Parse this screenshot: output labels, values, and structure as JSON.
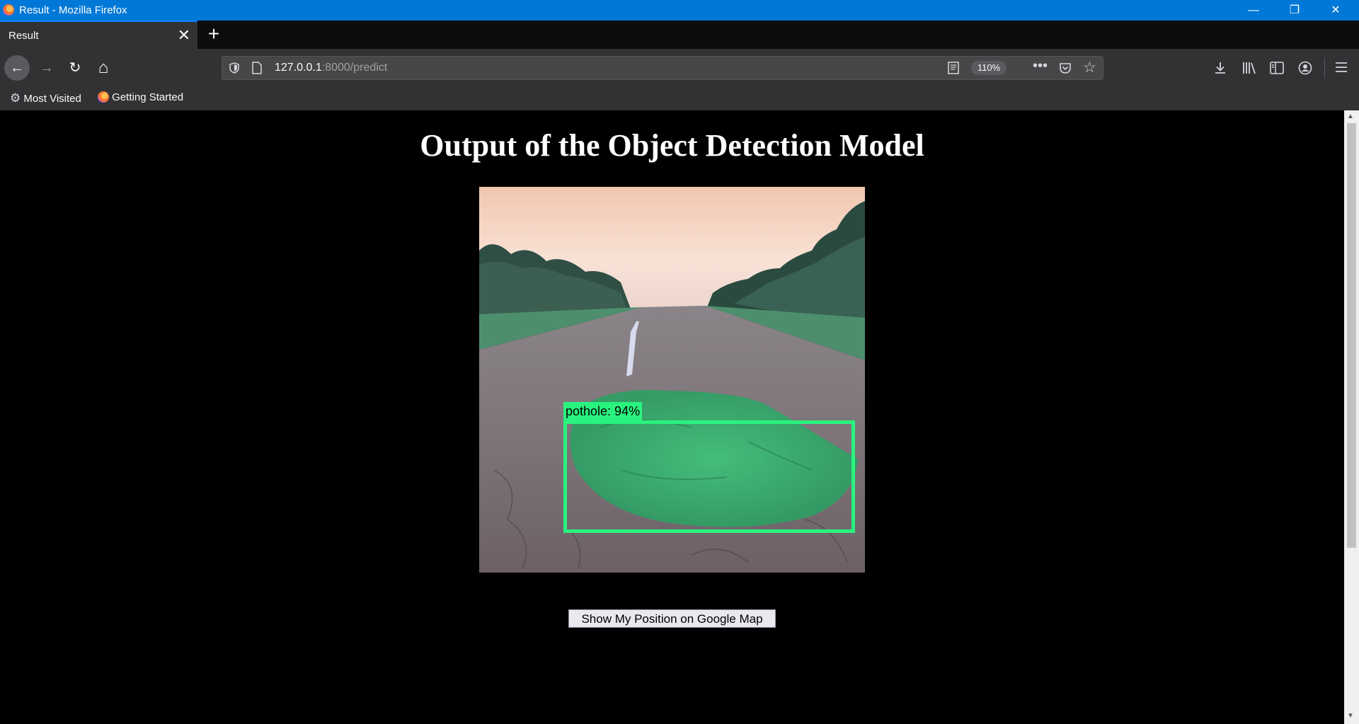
{
  "window": {
    "title": "Result - Mozilla Firefox",
    "minimize": "—",
    "restore": "❐",
    "close": "✕"
  },
  "tabs": [
    {
      "label": "Result",
      "close": "✕"
    }
  ],
  "new_tab": "+",
  "nav": {
    "back": "←",
    "forward": "→",
    "reload": "↻",
    "home": "⌂"
  },
  "urlbar": {
    "host": "127.0.0.1",
    "path": ":8000/predict",
    "zoom": "110%"
  },
  "toolbar_icons": [
    "reader-view-icon",
    "more-actions-icon",
    "pocket-icon",
    "bookmark-star-icon",
    "downloads-icon",
    "library-icon",
    "sidebar-icon",
    "account-icon",
    "menu-icon"
  ],
  "bookmarks": [
    {
      "label": "Most Visited",
      "icon": "gear-icon"
    },
    {
      "label": "Getting Started",
      "icon": "firefox-icon"
    }
  ],
  "page": {
    "heading": "Output of the Object Detection Model",
    "detection_label": "pothole: 94%",
    "button": "Show My Position on Google Map"
  },
  "colors": {
    "titlebar": "#0078d7",
    "detection": "#2af27f",
    "chrome": "#323234"
  }
}
